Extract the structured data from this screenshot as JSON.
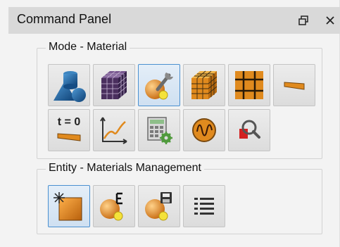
{
  "panel": {
    "title": "Command Panel"
  },
  "groups": {
    "mode": {
      "label": "Mode - Material"
    },
    "entity": {
      "label": "Entity - Materials Management"
    }
  },
  "tools": {
    "t_zero_label": "t = 0"
  },
  "icons": {
    "float": "restore-window-icon",
    "close": "close-icon"
  },
  "colors": {
    "active_border": "#4a90d0",
    "material_orange": "#e08a1e",
    "material_blue": "#2a6fa8",
    "solid_purple": "#5a3b6b"
  }
}
